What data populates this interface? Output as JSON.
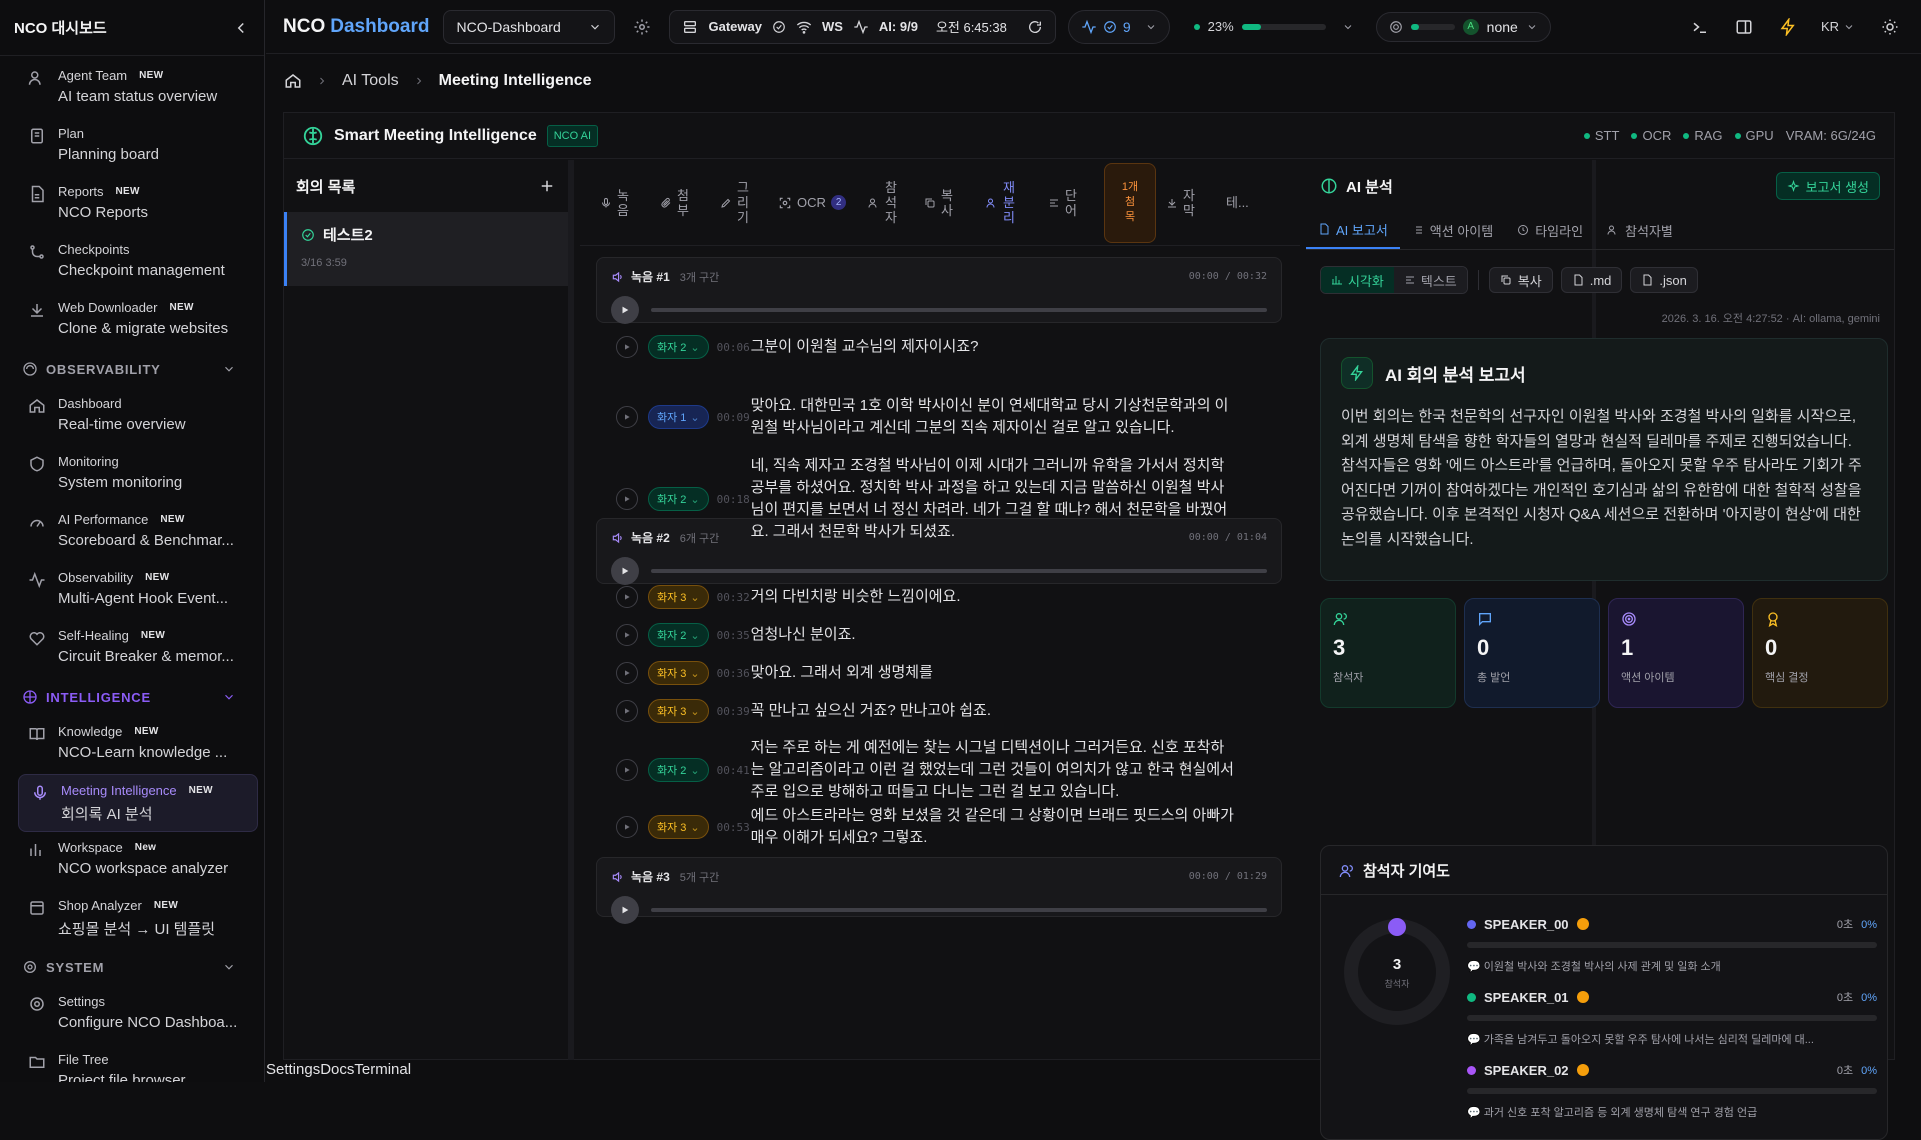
{
  "sidebar": {
    "title": "NCO 대시보드",
    "items_top": [
      {
        "name": "Agent Team",
        "badge": "NEW",
        "desc": "AI team status overview"
      },
      {
        "name": "Plan",
        "badge": "",
        "desc": "Planning board"
      },
      {
        "name": "Reports",
        "badge": "NEW",
        "desc": "NCO Reports"
      },
      {
        "name": "Checkpoints",
        "badge": "",
        "desc": "Checkpoint management"
      },
      {
        "name": "Web Downloader",
        "badge": "NEW",
        "desc": "Clone & migrate websites"
      }
    ],
    "sections": {
      "observability": "OBSERVABILITY",
      "intelligence": "INTELLIGENCE",
      "system": "SYSTEM"
    },
    "items_obs": [
      {
        "name": "Dashboard",
        "badge": "",
        "desc": "Real-time overview"
      },
      {
        "name": "Monitoring",
        "badge": "",
        "desc": "System monitoring"
      },
      {
        "name": "AI Performance",
        "badge": "NEW",
        "desc": "Scoreboard & Benchmar..."
      },
      {
        "name": "Observability",
        "badge": "NEW",
        "desc": "Multi-Agent Hook Event..."
      },
      {
        "name": "Self-Healing",
        "badge": "NEW",
        "desc": "Circuit Breaker & memor..."
      }
    ],
    "items_int": [
      {
        "name": "Knowledge",
        "badge": "NEW",
        "desc": "NCO-Learn knowledge ..."
      },
      {
        "name": "Meeting Intelligence",
        "badge": "NEW",
        "desc": "회의록 AI 분석"
      },
      {
        "name": "Workspace",
        "badge": "New",
        "desc": "NCO workspace analyzer"
      },
      {
        "name": "Shop Analyzer",
        "badge": "NEW",
        "desc": "쇼핑몰 분석 → UI 템플릿"
      }
    ],
    "items_sys": [
      {
        "name": "Settings",
        "badge": "",
        "desc": "Configure NCO Dashboa..."
      },
      {
        "name": "File Tree",
        "badge": "",
        "desc": "Project file browser"
      }
    ]
  },
  "topbar": {
    "brand_a": "NCO",
    "brand_b": "Dashboard",
    "workspace": "NCO-Dashboard",
    "gateway": "Gateway",
    "ws": "WS",
    "ai": "AI: 9/9",
    "time": "오전 6:45:38",
    "activity_count": "9",
    "cpu": "23%",
    "model": "none",
    "lang": "KR"
  },
  "breadcrumb": {
    "parent": "AI Tools",
    "current": "Meeting Intelligence"
  },
  "panel": {
    "title": "Smart Meeting Intelligence",
    "badge": "NCO AI",
    "status": [
      "STT",
      "OCR",
      "RAG",
      "GPU"
    ],
    "vram": "VRAM: 6G/24G"
  },
  "meetings": {
    "title": "회의 목록",
    "items": [
      {
        "name": "테스트2",
        "date": "3/16 3:59"
      }
    ]
  },
  "toolbar": {
    "record": "녹\n음",
    "attach": "첨\n부",
    "draw": "그\n리\n기",
    "ocr": "OCR",
    "ocr_count": "2",
    "participants": "참\n석\n자",
    "copy": "복\n사",
    "rediarize": "재\n분\n리",
    "paragraph": "단\n어",
    "correct": "1개\n첨\n목",
    "subtitle": "자\n막",
    "more": "테..."
  },
  "recordings": [
    {
      "label": "녹음 #1",
      "segments": "3개 구간",
      "time": "00:00 / 00:32"
    },
    {
      "label": "녹음 #2",
      "segments": "6개 구간",
      "time": "00:00 / 01:04"
    },
    {
      "label": "녹음 #3",
      "segments": "5개 구간",
      "time": "00:00 / 01:29"
    }
  ],
  "transcript": [
    {
      "speaker": "화자 2",
      "time": "00:06",
      "text": "그분이 이원철 교수님의 제자이시죠?"
    },
    {
      "speaker": "화자 1",
      "time": "00:09",
      "text": "맞아요. 대한민국 1호 이학 박사이신 분이 연세대학교 당시 기상천문학과의 이원철 박사님이라고 계신데 그분의 직속 제자이신 걸로 알고 있습니다."
    },
    {
      "speaker": "화자 2",
      "time": "00:18",
      "text": "네, 직속 제자고 조경철 박사님이 이제 시대가 그러니까 유학을 가서서 정치학 공부를 하셨어요. 정치학 박사 과정을 하고 있는데 지금 말씀하신 이원철 박사님이 편지를 보면서 너 정신 차려라. 네가 그걸 할 때냐? 해서 천문학을 바꿨어요. 그래서 천문학 박사가 되셨죠."
    },
    {
      "speaker": "화자 3",
      "time": "00:32",
      "text": "거의 다빈치랑 비슷한 느낌이에요."
    },
    {
      "speaker": "화자 2",
      "time": "00:35",
      "text": "엄청나신 분이죠."
    },
    {
      "speaker": "화자 3",
      "time": "00:36",
      "text": "맞아요. 그래서 외계 생명체를"
    },
    {
      "speaker": "화자 3",
      "time": "00:39",
      "text": "꼭 만나고 싶으신 거죠? 만나고야 쉽죠."
    },
    {
      "speaker": "화자 2",
      "time": "00:41",
      "text": "저는 주로 하는 게 예전에는 찾는 시그널 디텍션이나 그러거든요. 신호 포착하는 알고리즘이라고 이런 걸 했었는데 그런 것들이 여의치가 않고 한국 현실에서 주로 입으로 방해하고 떠들고 다니는 그런 걸 보고 있습니다."
    },
    {
      "speaker": "화자 3",
      "time": "00:53",
      "text": "에드 아스트라라는 영화 보셨을 것 같은데 그 상황이면 브래드 핏드스의 아빠가 매우 이해가 되세요? 그렇죠."
    }
  ],
  "analysis": {
    "title": "AI 분석",
    "report_btn": "보고서 생성",
    "tabs": [
      "AI 보고서",
      "액션 아이템",
      "타임라인",
      "참석자별"
    ],
    "view_visual": "시각화",
    "view_text": "텍스트",
    "copy": "복사",
    "md": ".md",
    "json": ".json",
    "meta": "2026. 3. 16. 오전 4:27:52 · AI: ollama, gemini",
    "report_title": "AI 회의 분석 보고서",
    "report_body": "이번 회의는 한국 천문학의 선구자인 이원철 박사와 조경철 박사의 일화를 시작으로, 외계 생명체 탐색을 향한 학자들의 열망과 현실적 딜레마를 주제로 진행되었습니다. 참석자들은 영화 '에드 아스트라'를 언급하며, 돌아오지 못할 우주 탐사라도 기회가 주어진다면 기꺼이 참여하겠다는 개인적인 호기심과 삶의 유한함에 대한 철학적 성찰을 공유했습니다. 이후 본격적인 시청자 Q&A 세션으로 전환하며 '아지랑이 현상'에 대한 논의를 시작했습니다.",
    "stats": [
      {
        "value": "3",
        "label": "참석자",
        "color": "#10b981"
      },
      {
        "value": "0",
        "label": "총 발언",
        "color": "#3b82f6"
      },
      {
        "value": "1",
        "label": "액션 아이템",
        "color": "#8b5cf6"
      },
      {
        "value": "0",
        "label": "핵심 결정",
        "color": "#f59e0b"
      }
    ],
    "contrib_title": "참석자 기여도",
    "donut_value": "3",
    "donut_label": "참석자",
    "speakers": [
      {
        "name": "SPEAKER_00",
        "count": "0초",
        "pct": "0%",
        "color": "#6366f1",
        "note": "이원철 박사와 조경철 박사의 사제 관계 및 일화 소개"
      },
      {
        "name": "SPEAKER_01",
        "count": "0초",
        "pct": "0%",
        "color": "#10b981",
        "note": "가족을 남겨두고 돌아오지 못할 우주 탐사에 나서는 심리적 딜레마에 대..."
      },
      {
        "name": "SPEAKER_02",
        "count": "0초",
        "pct": "0%",
        "color": "#a855f7",
        "note": "과거 신호 포착 알고리즘 등 외계 생명체 탐색 연구 경험 언급"
      }
    ]
  },
  "footer": {
    "text": "SettingsDocsTerminal"
  }
}
